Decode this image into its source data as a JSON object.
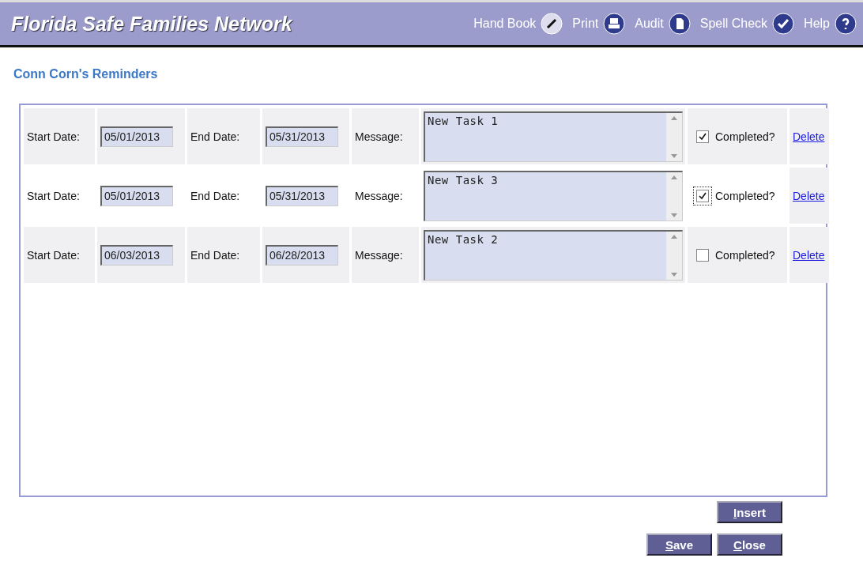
{
  "header": {
    "title": "Florida Safe Families Network",
    "tools": [
      {
        "label": "Hand Book",
        "kind": "book"
      },
      {
        "label": "Print",
        "kind": "print"
      },
      {
        "label": "Audit",
        "kind": "audit"
      },
      {
        "label": "Spell Check",
        "kind": "spell"
      },
      {
        "label": "Help",
        "kind": "help"
      }
    ]
  },
  "page_title": "Conn Corn's Reminders",
  "reminders": [
    {
      "start_label": "Start Date:",
      "start": "05/01/2013",
      "end_label": "End Date:",
      "end": "05/31/2013",
      "message_label": "Message:",
      "message": "New Task 1",
      "completed_label": "Completed?",
      "completed": true,
      "focused": false,
      "delete": "Delete"
    },
    {
      "start_label": "Start Date:",
      "start": "05/01/2013",
      "end_label": "End Date:",
      "end": "05/31/2013",
      "message_label": "Message:",
      "message": "New Task 3",
      "completed_label": "Completed?",
      "completed": true,
      "focused": true,
      "delete": "Delete"
    },
    {
      "start_label": "Start Date:",
      "start": "06/03/2013",
      "end_label": "End Date:",
      "end": "06/28/2013",
      "message_label": "Message:",
      "message": "New Task 2",
      "completed_label": "Completed?",
      "completed": false,
      "focused": false,
      "delete": "Delete"
    }
  ],
  "buttons": {
    "insert": "Insert",
    "save": "Save",
    "close": "Close"
  }
}
